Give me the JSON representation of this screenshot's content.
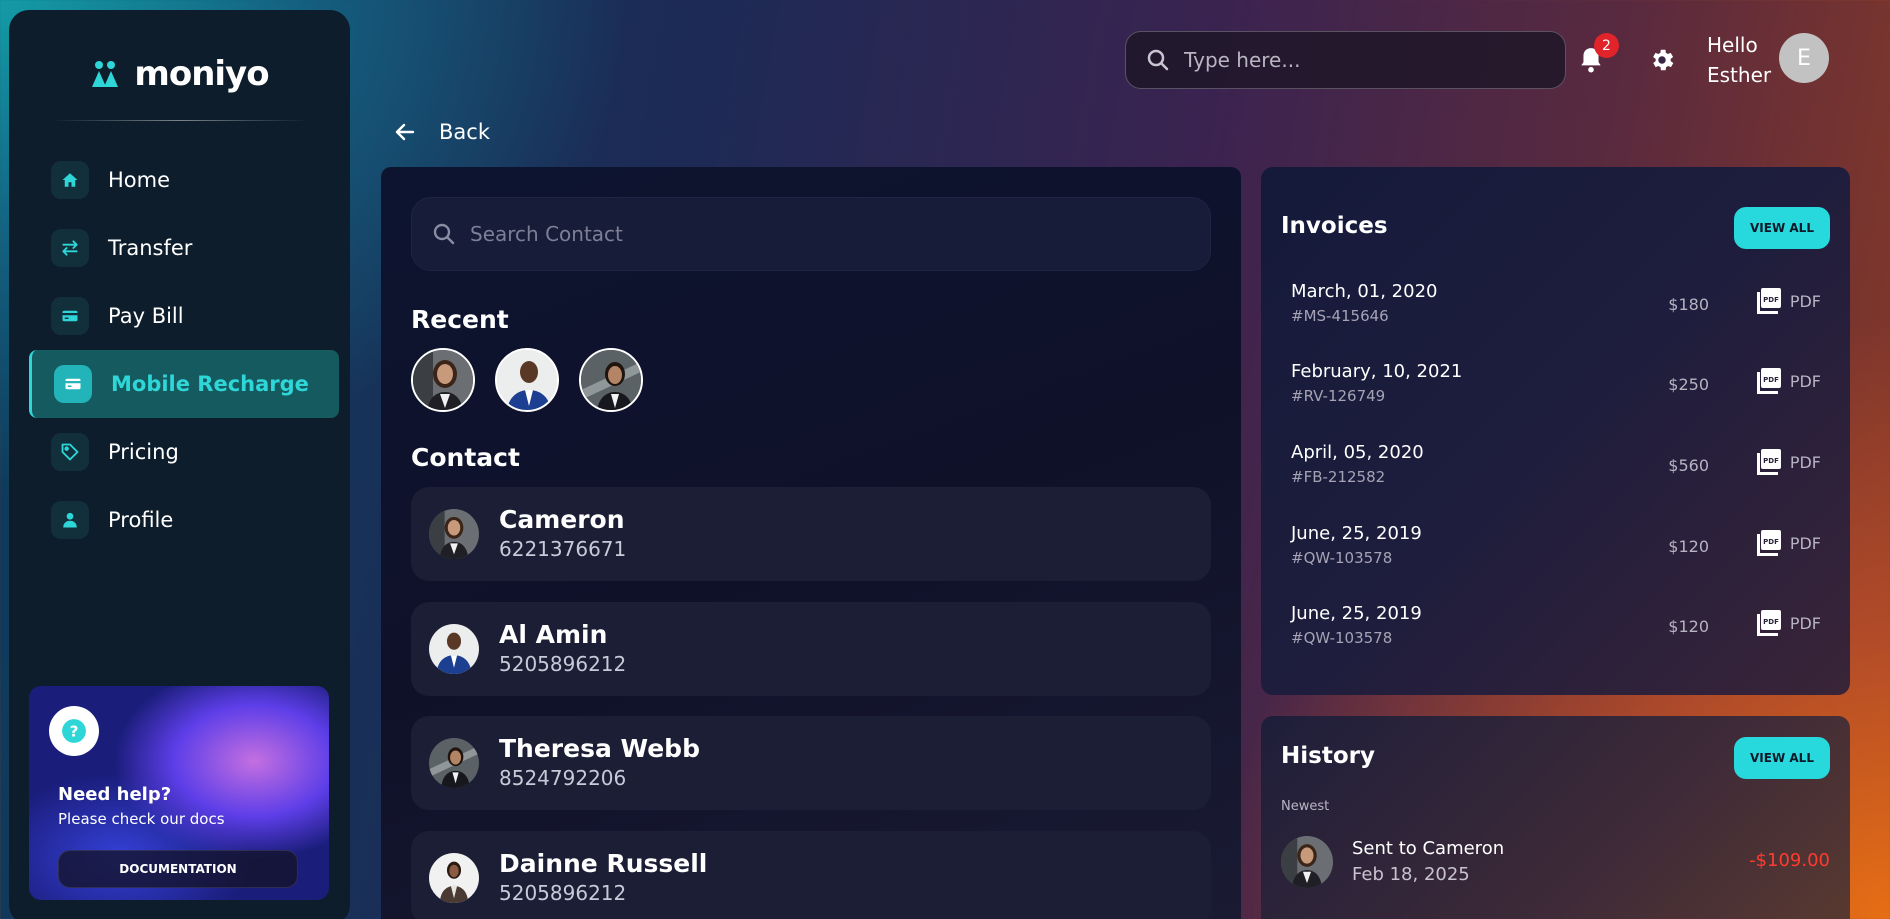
{
  "brand": {
    "name": "moniyo"
  },
  "sidebar": {
    "items": [
      {
        "label": "Home",
        "icon": "home-icon"
      },
      {
        "label": "Transfer",
        "icon": "transfer-icon"
      },
      {
        "label": "Pay Bill",
        "icon": "card-icon"
      },
      {
        "label": "Mobile Recharge",
        "icon": "card-icon",
        "active": true
      },
      {
        "label": "Pricing",
        "icon": "tag-icon"
      },
      {
        "label": "Profile",
        "icon": "user-icon"
      }
    ],
    "help": {
      "title": "Need help?",
      "subtitle": "Please check our docs",
      "button": "DOCUMENTATION"
    }
  },
  "header": {
    "search_placeholder": "Type here...",
    "notifications": "2",
    "greeting_line1": "Hello",
    "greeting_line2": "Esther",
    "avatar_initial": "E"
  },
  "back_label": "Back",
  "contacts_panel": {
    "search_placeholder": "Search Contact",
    "recent_title": "Recent",
    "contact_title": "Contact",
    "contacts": [
      {
        "name": "Cameron",
        "phone": "6221376671"
      },
      {
        "name": "Al Amin",
        "phone": "5205896212"
      },
      {
        "name": "Theresa Webb",
        "phone": "8524792206"
      },
      {
        "name": "Dainne Russell",
        "phone": "5205896212"
      }
    ]
  },
  "invoices": {
    "title": "Invoices",
    "view_all": "VIEW ALL",
    "rows": [
      {
        "date": "March, 01, 2020",
        "id": "#MS-415646",
        "amount": "$180",
        "format": "PDF"
      },
      {
        "date": "February, 10, 2021",
        "id": "#RV-126749",
        "amount": "$250",
        "format": "PDF"
      },
      {
        "date": "April, 05, 2020",
        "id": "#FB-212582",
        "amount": "$560",
        "format": "PDF"
      },
      {
        "date": "June, 25, 2019",
        "id": "#QW-103578",
        "amount": "$120",
        "format": "PDF"
      },
      {
        "date": "June, 25, 2019",
        "id": "#QW-103578",
        "amount": "$120",
        "format": "PDF"
      }
    ]
  },
  "history": {
    "title": "History",
    "view_all": "VIEW ALL",
    "group": "Newest",
    "items": [
      {
        "title": "Sent to Cameron",
        "date": "Feb 18, 2025",
        "amount": "-$109.00"
      }
    ]
  },
  "colors": {
    "accent": "#2ed6d8",
    "negative": "#ff3b30",
    "badge": "#e0242a"
  }
}
